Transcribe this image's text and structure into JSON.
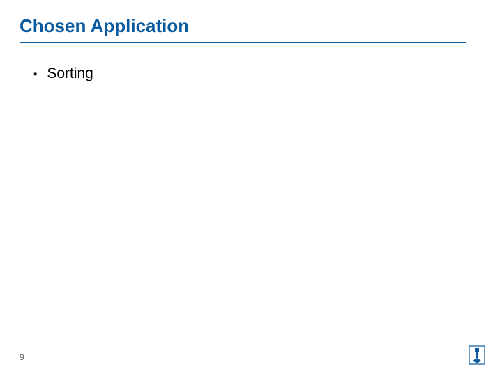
{
  "slide": {
    "title": "Chosen Application",
    "bullets": [
      {
        "text": "Sorting"
      }
    ],
    "page_number": "9"
  },
  "colors": {
    "accent": "#0a5aa0"
  },
  "icons": {
    "logo": "institution-logo"
  }
}
